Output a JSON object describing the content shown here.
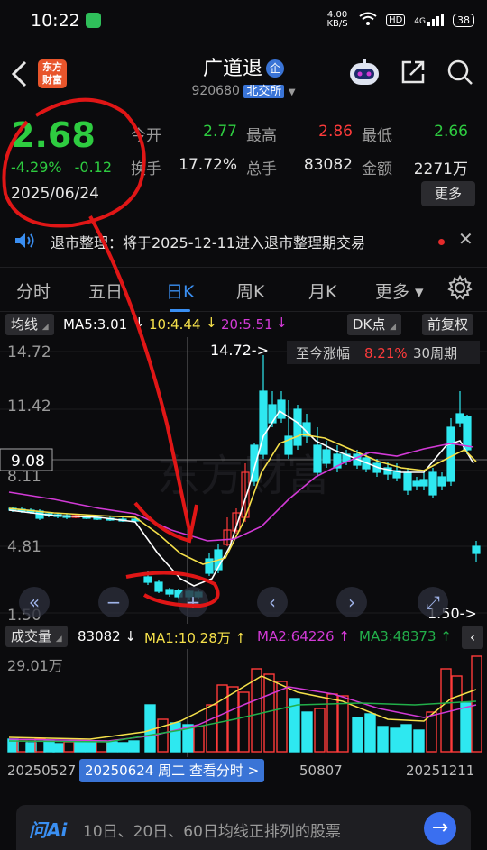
{
  "status": {
    "time": "10:22",
    "speed": "4.00 KB/S",
    "hd": "HD",
    "net": "4G",
    "battery": "38"
  },
  "header": {
    "logo_text": "东方财富",
    "title": "广道退",
    "badge": "企",
    "code": "920680",
    "exchange": "北交所"
  },
  "quote": {
    "price": "2.68",
    "pct": "-4.29%",
    "chg": "-0.12",
    "date": "2025/06/24"
  },
  "stats": [
    [
      {
        "label": "今开",
        "value": "2.77",
        "color": "#2ecc40"
      },
      {
        "label": "最高",
        "value": "2.86",
        "color": "#ff3b3b"
      },
      {
        "label": "最低",
        "value": "2.66",
        "color": "#2ecc40"
      }
    ],
    [
      {
        "label": "换手",
        "value": "17.72%",
        "color": "#e6e6e6"
      },
      {
        "label": "总手",
        "value": "83082",
        "color": "#e6e6e6"
      },
      {
        "label": "金额",
        "value": "2271万",
        "color": "#e6e6e6"
      }
    ]
  ],
  "more_label": "更多",
  "notice": "退市整理：将于2025-12-11进入退市整理期交易",
  "tabs": [
    "分时",
    "五日",
    "日K",
    "周K",
    "月K",
    "更多"
  ],
  "active_tab": "日K",
  "ma": {
    "kind": "均线",
    "ma5": "MA5:3.01",
    "ma10": "10:4.44",
    "ma20": "20:5.51",
    "dk": "DK点",
    "adj": "前复权"
  },
  "kline": {
    "y_labels": [
      "14.72",
      "11.42",
      "8.11",
      "4.81",
      "1.50"
    ],
    "cross_price": "9.08",
    "hi_label": "14.72->",
    "lo_label": "1.50->",
    "range_label": "至今涨幅",
    "range_pct": "8.21%",
    "range_period": "30周期",
    "watermark": "东方财富"
  },
  "volume": {
    "kind": "成交量",
    "vol": "83082",
    "ma1": "MA1:10.28万",
    "ma2": "MA2:64226",
    "ma3": "MA3:48373",
    "max_label": "29.01万"
  },
  "xaxis": {
    "start": "20250527",
    "cross": "20250624 周二 查看分时 >",
    "mid": "50807",
    "end": "20251211"
  },
  "ai": {
    "brand": "问Ai",
    "query": "10日、20日、60日均线正排列的股票"
  },
  "colors": {
    "up": "#ff3b3b",
    "down": "#2ee8f0",
    "ma5": "#ffffff",
    "ma10": "#f5e04a",
    "ma20": "#d23ad6",
    "ma3": "#22b04a",
    "accent": "#3a8ff2"
  }
}
